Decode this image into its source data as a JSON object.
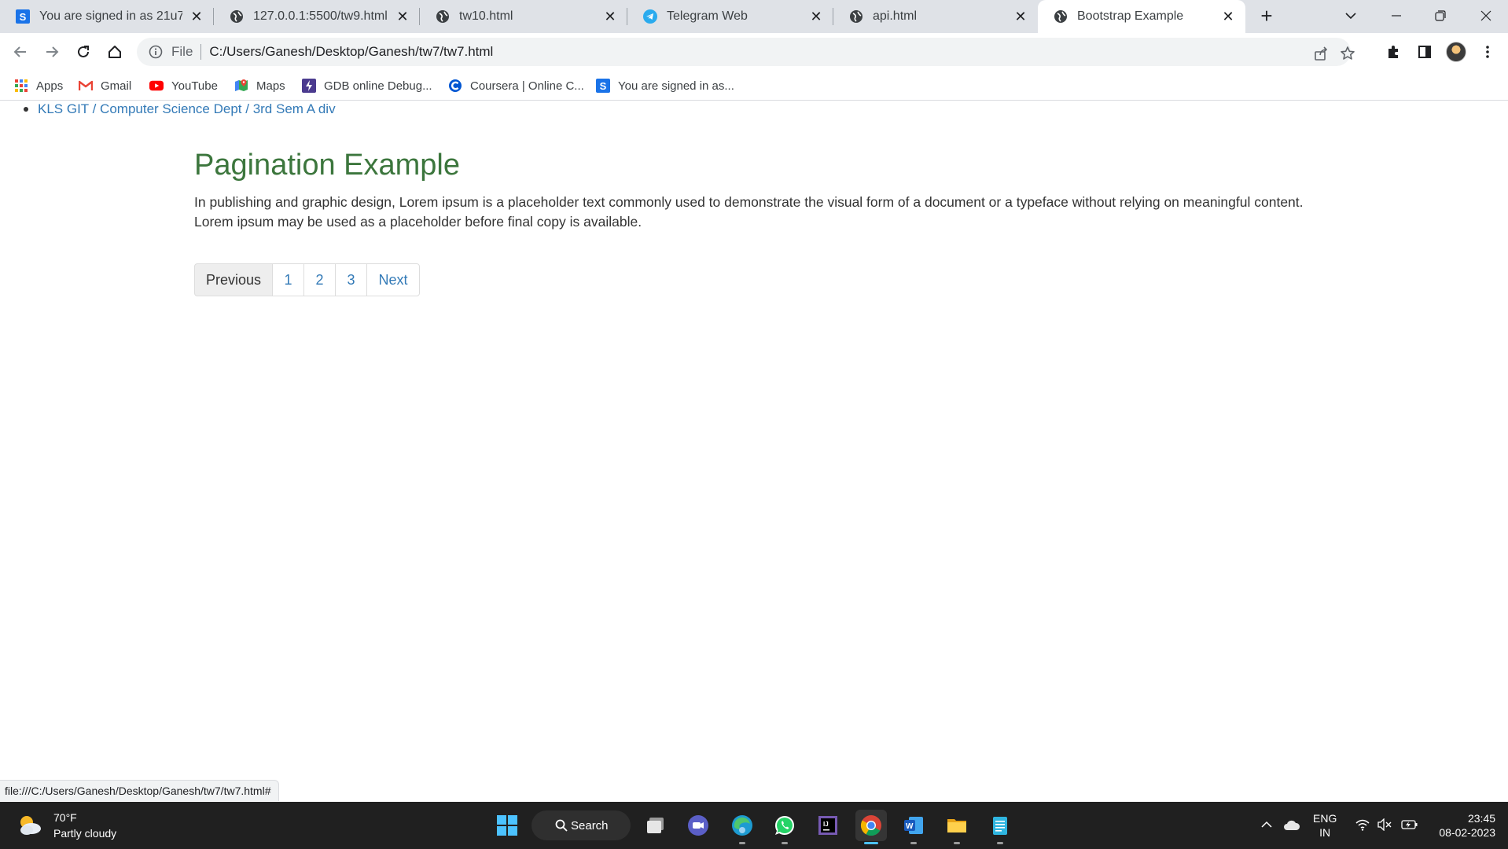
{
  "browser": {
    "tabs": [
      {
        "title": "You are signed in as 21u76",
        "icon": "s-logo-icon"
      },
      {
        "title": "127.0.0.1:5500/tw9.html",
        "icon": "globe-icon"
      },
      {
        "title": "tw10.html",
        "icon": "globe-icon"
      },
      {
        "title": "Telegram Web",
        "icon": "telegram-icon"
      },
      {
        "title": "api.html",
        "icon": "globe-icon"
      },
      {
        "title": "Bootstrap Example",
        "icon": "globe-icon",
        "active": true
      }
    ],
    "omnibox": {
      "scheme_label": "File",
      "url": "C:/Users/Ganesh/Desktop/Ganesh/tw7/tw7.html"
    },
    "bookmarks": [
      {
        "label": "Apps",
        "icon": "apps-grid-icon"
      },
      {
        "label": "Gmail",
        "icon": "gmail-icon"
      },
      {
        "label": "YouTube",
        "icon": "youtube-icon"
      },
      {
        "label": "Maps",
        "icon": "maps-icon"
      },
      {
        "label": "GDB online Debug...",
        "icon": "gdb-icon"
      },
      {
        "label": "Coursera | Online C...",
        "icon": "coursera-icon"
      },
      {
        "label": "You are signed in as...",
        "icon": "s-logo-icon"
      }
    ],
    "status_url": "file:///C:/Users/Ganesh/Desktop/Ganesh/tw7/tw7.html#"
  },
  "page": {
    "breadcrumb": "KLS GIT / Computer Science Dept / 3rd Sem A div",
    "title": "Pagination Example",
    "paragraph": "In publishing and graphic design, Lorem ipsum is a placeholder text commonly used to demonstrate the visual form of a document or a typeface without relying on meaningful content. Lorem ipsum may be used as a placeholder before final copy is available.",
    "pagination": [
      "Previous",
      "1",
      "2",
      "3",
      "Next"
    ]
  },
  "taskbar": {
    "weather_temp": "70°F",
    "weather_desc": "Partly cloudy",
    "search_label": "Search",
    "lang_top": "ENG",
    "lang_bottom": "IN",
    "time": "23:45",
    "date": "08-02-2023"
  },
  "colors": {
    "title_green": "#3c763d",
    "link_blue": "#337ab7",
    "tabstrip": "#dfe2e7",
    "taskbar": "#202020"
  }
}
